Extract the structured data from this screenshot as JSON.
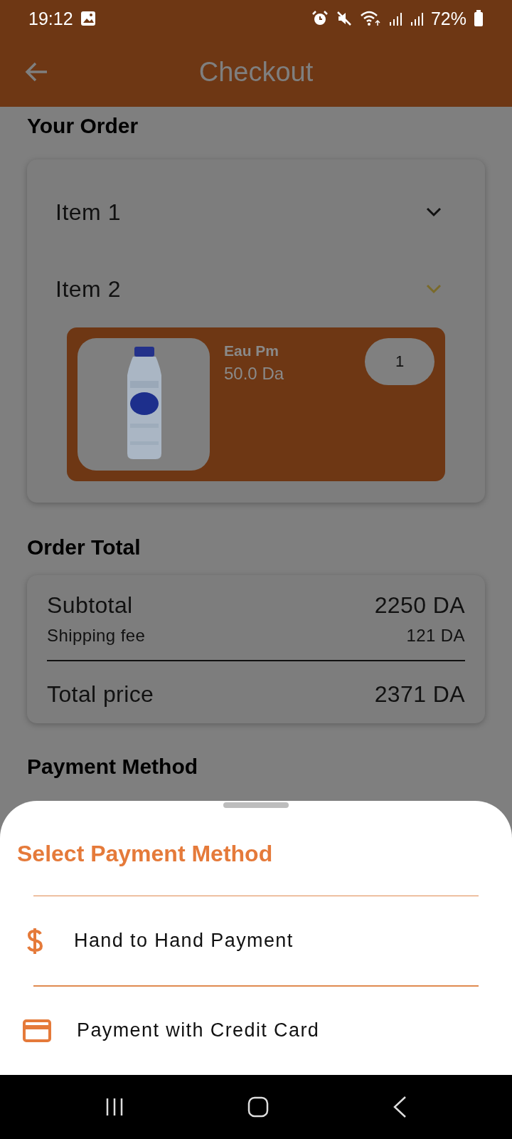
{
  "status_bar": {
    "time": "19:12",
    "battery": "72%"
  },
  "app_bar": {
    "title": "Checkout"
  },
  "order": {
    "title": "Your Order",
    "items": [
      {
        "label": "Item 1",
        "expanded": false
      },
      {
        "label": "Item 2",
        "expanded": true,
        "products": [
          {
            "name": "Eau Pm",
            "price": "50.0 Da",
            "quantity": "1"
          }
        ]
      }
    ]
  },
  "order_total": {
    "title": "Order Total",
    "rows": [
      {
        "kind": "main",
        "label": "Subtotal",
        "value": "2250 DA"
      },
      {
        "kind": "minor",
        "label": "Shipping fee",
        "value": "121 DA"
      },
      {
        "kind": "total",
        "label": "Total price",
        "value": "2371 DA"
      }
    ]
  },
  "payment": {
    "title": "Payment Method"
  },
  "sheet": {
    "title": "Select Payment Method",
    "options": [
      {
        "kind": "cash",
        "label": "Hand to Hand Payment"
      },
      {
        "kind": "card",
        "label": "Payment with Credit Card"
      }
    ]
  }
}
